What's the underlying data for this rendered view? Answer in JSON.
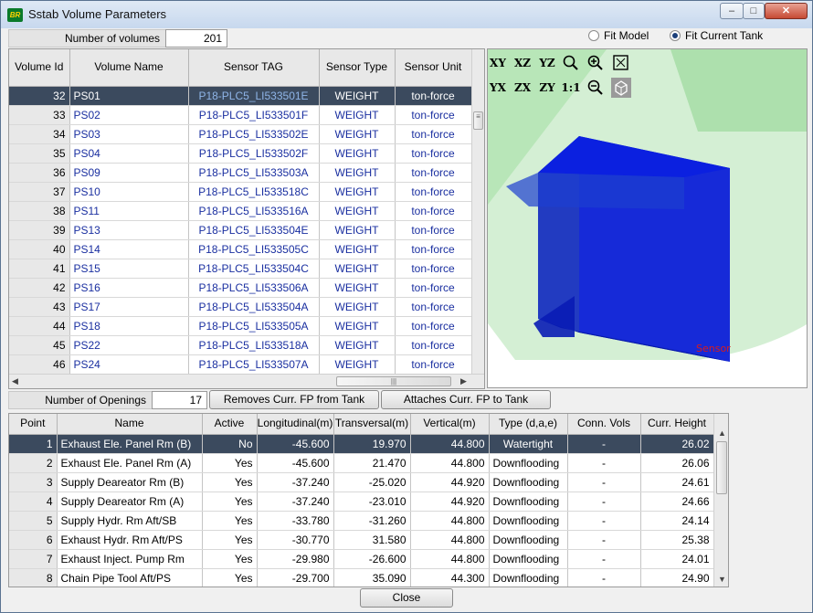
{
  "window": {
    "title": "Sstab Volume Parameters",
    "icon_text": "BR",
    "minimize": "–",
    "maximize": "□",
    "close": "✕"
  },
  "volumes": {
    "count_label": "Number of volumes",
    "count_value": "201",
    "columns": [
      "Volume Id",
      "Volume Name",
      "Sensor TAG",
      "Sensor Type",
      "Sensor Unit"
    ],
    "rows": [
      [
        "32",
        "PS01",
        "P18-PLC5_LI533501E",
        "WEIGHT",
        "ton-force"
      ],
      [
        "33",
        "PS02",
        "P18-PLC5_LI533501F",
        "WEIGHT",
        "ton-force"
      ],
      [
        "34",
        "PS03",
        "P18-PLC5_LI533502E",
        "WEIGHT",
        "ton-force"
      ],
      [
        "35",
        "PS04",
        "P18-PLC5_LI533502F",
        "WEIGHT",
        "ton-force"
      ],
      [
        "36",
        "PS09",
        "P18-PLC5_LI533503A",
        "WEIGHT",
        "ton-force"
      ],
      [
        "37",
        "PS10",
        "P18-PLC5_LI533518C",
        "WEIGHT",
        "ton-force"
      ],
      [
        "38",
        "PS11",
        "P18-PLC5_LI533516A",
        "WEIGHT",
        "ton-force"
      ],
      [
        "39",
        "PS13",
        "P18-PLC5_LI533504E",
        "WEIGHT",
        "ton-force"
      ],
      [
        "40",
        "PS14",
        "P18-PLC5_LI533505C",
        "WEIGHT",
        "ton-force"
      ],
      [
        "41",
        "PS15",
        "P18-PLC5_LI533504C",
        "WEIGHT",
        "ton-force"
      ],
      [
        "42",
        "PS16",
        "P18-PLC5_LI533506A",
        "WEIGHT",
        "ton-force"
      ],
      [
        "43",
        "PS17",
        "P18-PLC5_LI533504A",
        "WEIGHT",
        "ton-force"
      ],
      [
        "44",
        "PS18",
        "P18-PLC5_LI533505A",
        "WEIGHT",
        "ton-force"
      ],
      [
        "45",
        "PS22",
        "P18-PLC5_LI533518A",
        "WEIGHT",
        "ton-force"
      ],
      [
        "46",
        "PS24",
        "P18-PLC5_LI533507A",
        "WEIGHT",
        "ton-force"
      ]
    ],
    "selected_index": 0
  },
  "view_options": {
    "fit_model": "Fit Model",
    "fit_current_tank": "Fit Current Tank",
    "selected": "fit_current_tank"
  },
  "viewer_tools": {
    "row1": [
      "XY",
      "XZ",
      "YZ"
    ],
    "row2": [
      "YX",
      "ZX",
      "ZY",
      "1:1"
    ],
    "sensor_label": "Sensor"
  },
  "openings": {
    "count_label": "Number of Openings",
    "count_value": "17",
    "remove_button": "Removes Curr. FP from Tank",
    "attach_button": "Attaches Curr. FP to Tank",
    "columns": [
      "Point",
      "Name",
      "Active",
      "Longitudinal(m)",
      "Transversal(m)",
      "Vertical(m)",
      "Type (d,a,e)",
      "Conn. Vols",
      "Curr. Height"
    ],
    "rows": [
      [
        "1",
        "Exhaust Ele. Panel Rm (B)",
        "No",
        "-45.600",
        "19.970",
        "44.800",
        "Watertight",
        "-",
        "26.02"
      ],
      [
        "2",
        "Exhaust Ele. Panel Rm (A)",
        "Yes",
        "-45.600",
        "21.470",
        "44.800",
        "Downflooding",
        "-",
        "26.06"
      ],
      [
        "3",
        "Supply Deareator Rm (B)",
        "Yes",
        "-37.240",
        "-25.020",
        "44.920",
        "Downflooding",
        "-",
        "24.61"
      ],
      [
        "4",
        "Supply Deareator Rm (A)",
        "Yes",
        "-37.240",
        "-23.010",
        "44.920",
        "Downflooding",
        "-",
        "24.66"
      ],
      [
        "5",
        "Supply Hydr. Rm Aft/SB",
        "Yes",
        "-33.780",
        "-31.260",
        "44.800",
        "Downflooding",
        "-",
        "24.14"
      ],
      [
        "6",
        "Exhaust Hydr. Rm Aft/PS",
        "Yes",
        "-30.770",
        "31.580",
        "44.800",
        "Downflooding",
        "-",
        "25.38"
      ],
      [
        "7",
        "Exhaust Inject. Pump Rm",
        "Yes",
        "-29.980",
        "-26.600",
        "44.800",
        "Downflooding",
        "-",
        "24.01"
      ],
      [
        "8",
        "Chain Pipe Tool Aft/PS",
        "Yes",
        "-29.700",
        "35.090",
        "44.300",
        "Downflooding",
        "-",
        "24.90"
      ]
    ],
    "selected_index": 0
  },
  "footer": {
    "close_button": "Close"
  },
  "colors": {
    "selection": "#3b4a5e",
    "link_text": "#1a2fa0",
    "tank_blue": "#0a1fcf",
    "model_green": "#b8e8b8"
  }
}
